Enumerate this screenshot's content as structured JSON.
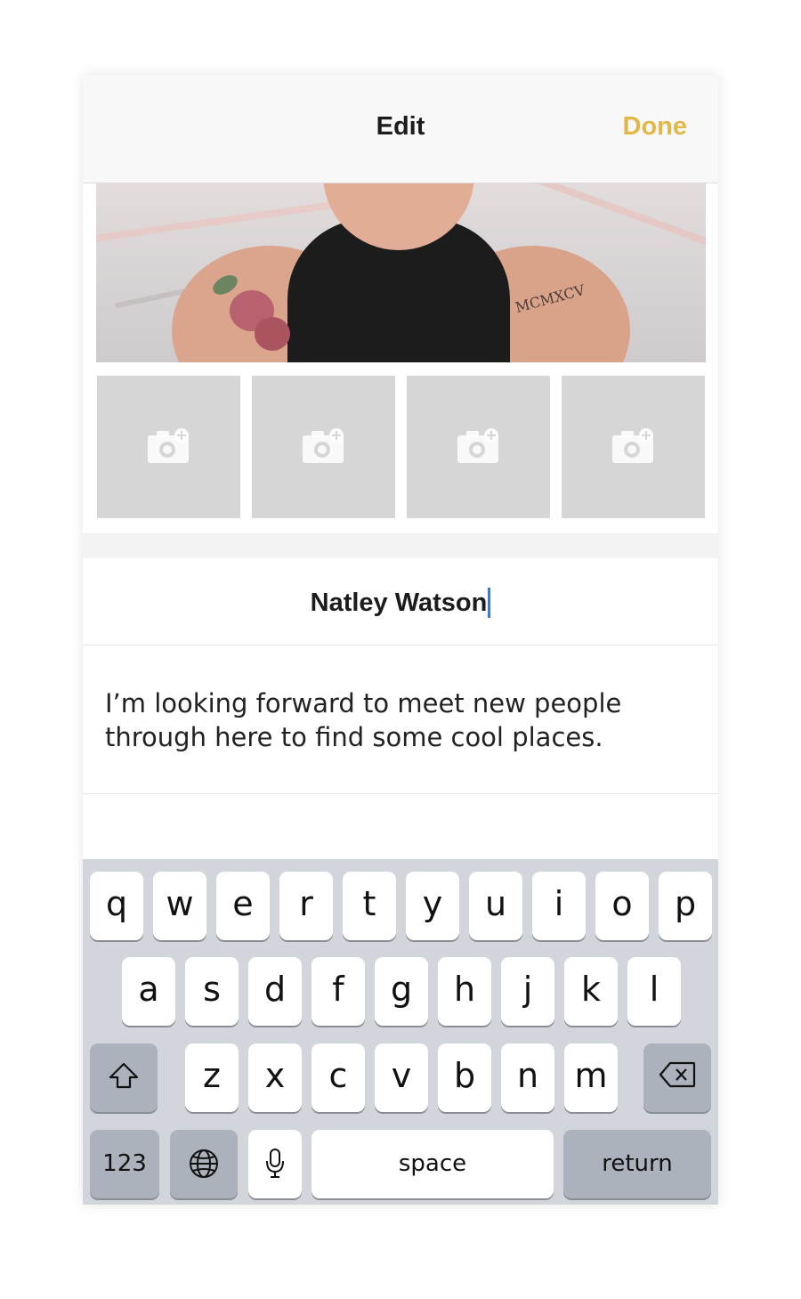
{
  "navbar": {
    "title": "Edit",
    "done_label": "Done"
  },
  "photos": {
    "main_tattoo_text": "MCMXCV",
    "slots": [
      {
        "icon": "camera-plus-icon"
      },
      {
        "icon": "camera-plus-icon"
      },
      {
        "icon": "camera-plus-icon"
      },
      {
        "icon": "camera-plus-icon"
      }
    ]
  },
  "profile": {
    "name": "Natley Watson",
    "bio": "I’m looking forward to meet new people through here to find some cool places."
  },
  "keyboard": {
    "row1": [
      "q",
      "w",
      "e",
      "r",
      "t",
      "y",
      "u",
      "i",
      "o",
      "p"
    ],
    "row2": [
      "a",
      "s",
      "d",
      "f",
      "g",
      "h",
      "j",
      "k",
      "l"
    ],
    "row3": [
      "z",
      "x",
      "c",
      "v",
      "b",
      "n",
      "m"
    ],
    "numbers_label": "123",
    "space_label": "space",
    "return_label": "return",
    "shift_icon": "shift-icon",
    "delete_icon": "backspace-icon",
    "globe_icon": "globe-icon",
    "mic_icon": "microphone-icon"
  },
  "colors": {
    "accent": "#e3b64a",
    "cursor": "#3a7bd5",
    "keyboard_bg": "#d2d5db"
  }
}
